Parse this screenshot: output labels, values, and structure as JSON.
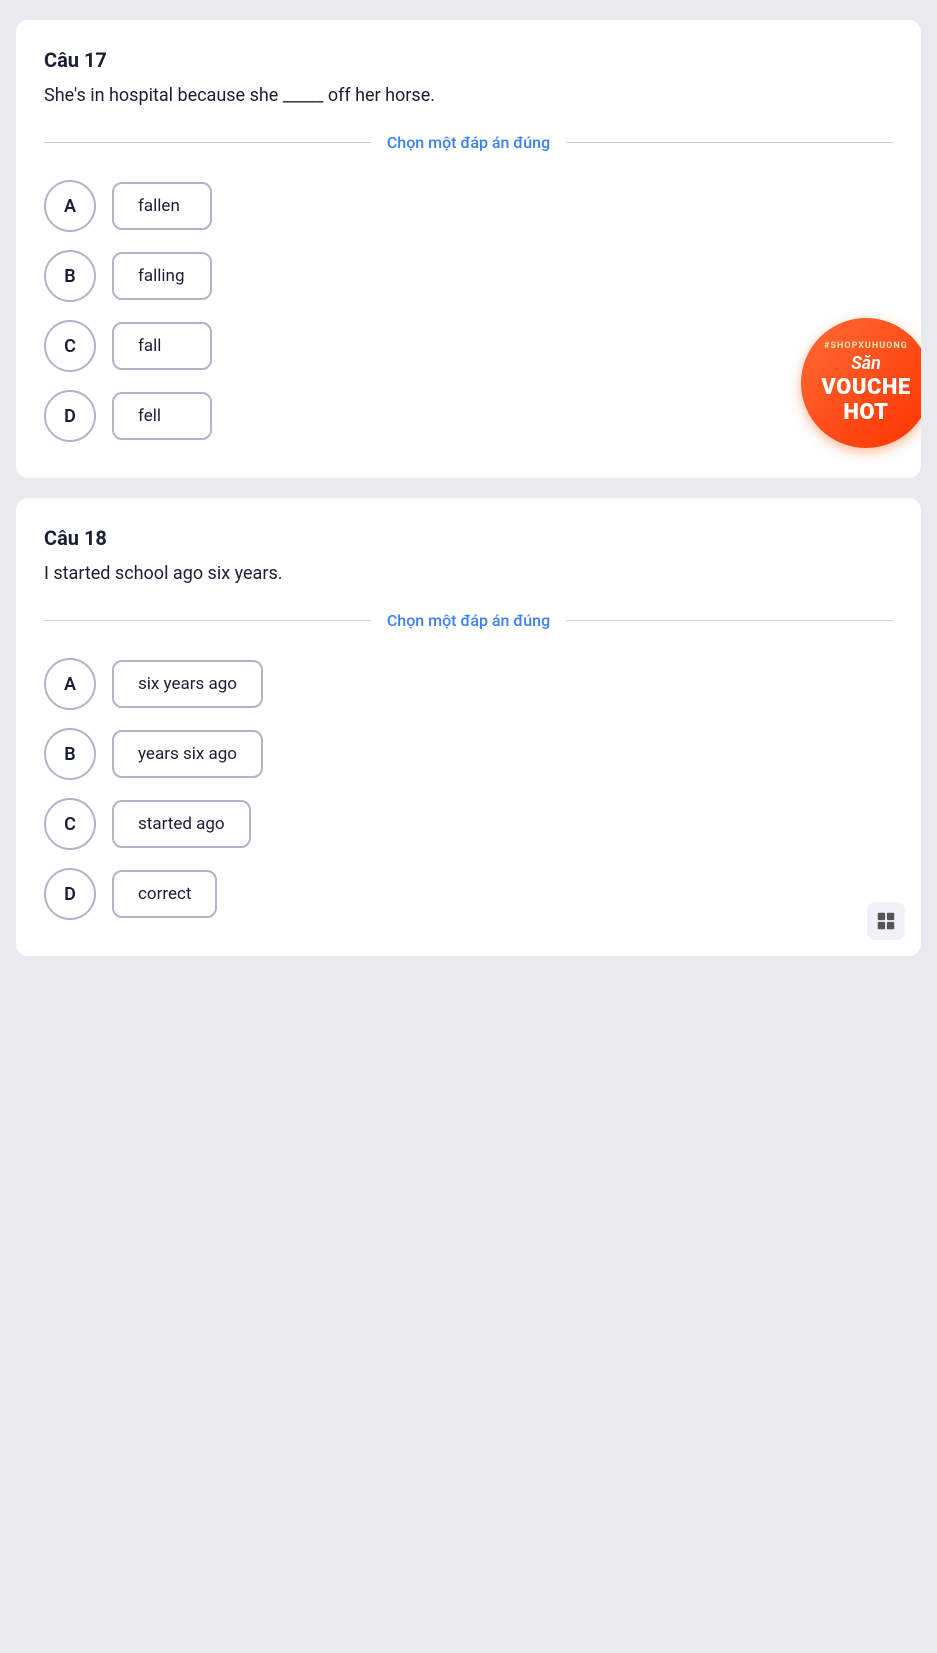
{
  "question17": {
    "number": "Câu 17",
    "text": "She's in hospital because she _____ off her horse.",
    "divider_label": "Chọn một đáp án đúng",
    "options": [
      {
        "letter": "A",
        "text": "fallen"
      },
      {
        "letter": "B",
        "text": "falling"
      },
      {
        "letter": "C",
        "text": "fall"
      },
      {
        "letter": "D",
        "text": "fell"
      }
    ]
  },
  "question18": {
    "number": "Câu 18",
    "text": "I started school ago six years.",
    "divider_label": "Chọn một đáp án đúng",
    "options": [
      {
        "letter": "A",
        "text": "six years ago"
      },
      {
        "letter": "B",
        "text": "years six ago"
      },
      {
        "letter": "C",
        "text": "started ago"
      },
      {
        "letter": "D",
        "text": "correct"
      }
    ]
  },
  "voucher": {
    "tag": "#SHOPXUHUONG",
    "san": "Săn",
    "main": "VOUCHE HOT"
  }
}
